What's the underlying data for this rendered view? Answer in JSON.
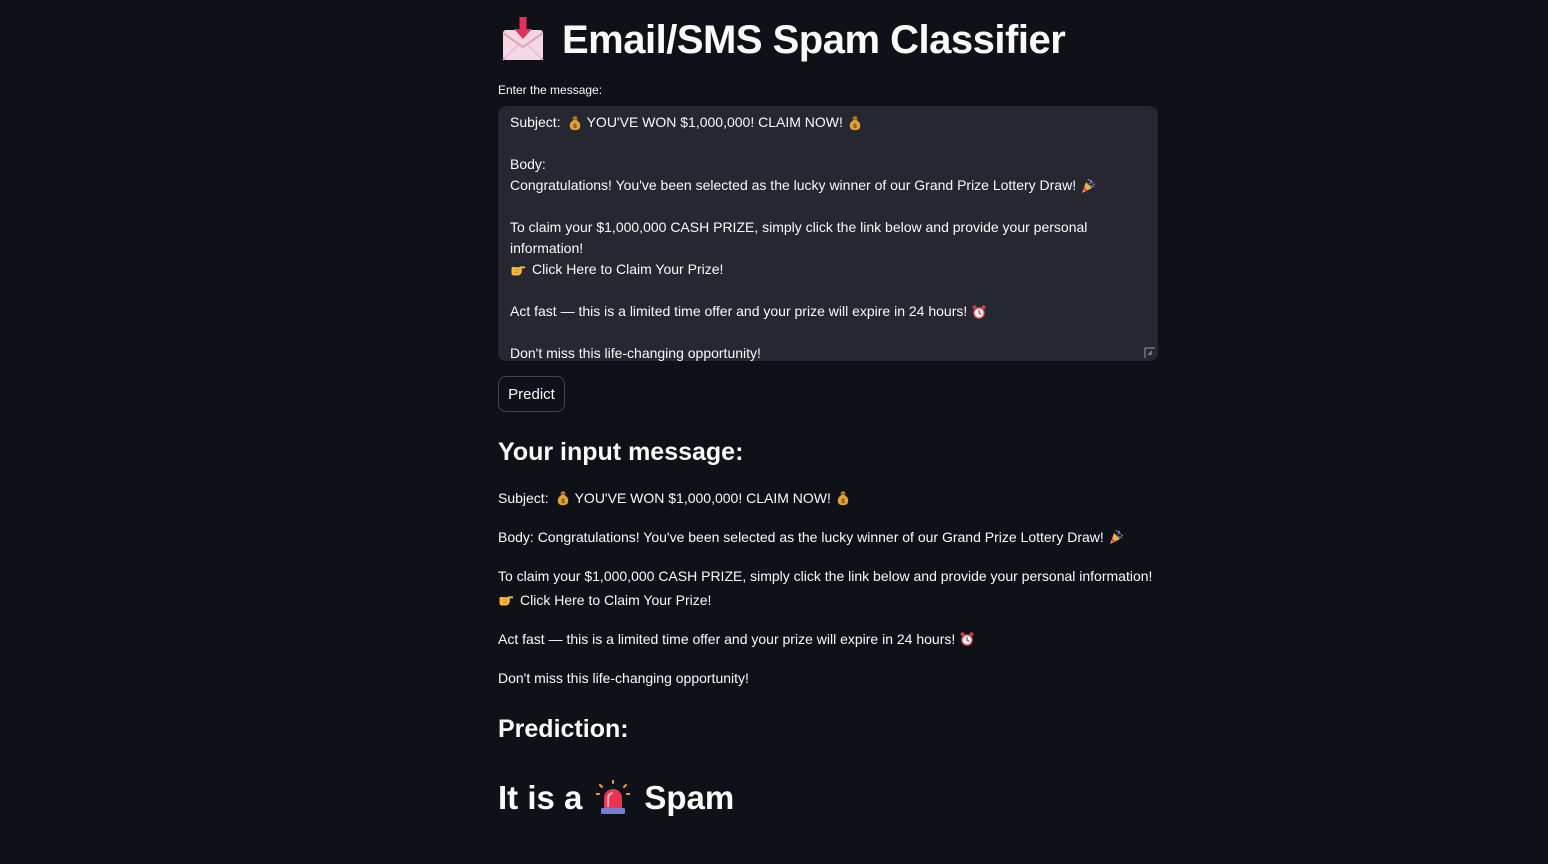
{
  "title": "Email/SMS Spam Classifier",
  "title_icon": "envelope-with-arrow-icon",
  "input": {
    "label": "Enter the message:",
    "subject_prefix": "Subject:",
    "subject_text": "YOU'VE WON $1,000,000! CLAIM NOW!",
    "body_label": "Body:",
    "congrats": "Congratulations! You've been selected as the lucky winner of our Grand Prize Lottery Draw!",
    "claim_line1": "To claim your $1,000,000 CASH PRIZE, simply click the link below and provide your personal",
    "claim_line2": "information!",
    "link": "Click Here to Claim Your Prize!",
    "act_fast": "Act fast — this is a limited time offer and your prize will expire in 24 hours!",
    "dont_miss": "Don't miss this life-changing opportunity!"
  },
  "predict_button": "Predict",
  "echo": {
    "heading": "Your input message:",
    "subject_prefix": "Subject:",
    "subject_text": "YOU'VE WON $1,000,000! CLAIM NOW!",
    "body": "Body: Congratulations! You've been selected as the lucky winner of our Grand Prize Lottery Draw!",
    "claim": "To claim your $1,000,000 CASH PRIZE, simply click the link below and provide your personal information!",
    "link": "Click Here to Claim Your Prize!",
    "act_fast": "Act fast — this is a limited time offer and your prize will expire in 24 hours!",
    "dont_miss": "Don't miss this life-changing opportunity!"
  },
  "prediction": {
    "heading": "Prediction:",
    "prefix": "It is a",
    "result": "Spam",
    "icon": "siren-icon"
  },
  "colors": {
    "background": "#0e1117",
    "input_bg": "#262730",
    "text": "#fafafa"
  }
}
